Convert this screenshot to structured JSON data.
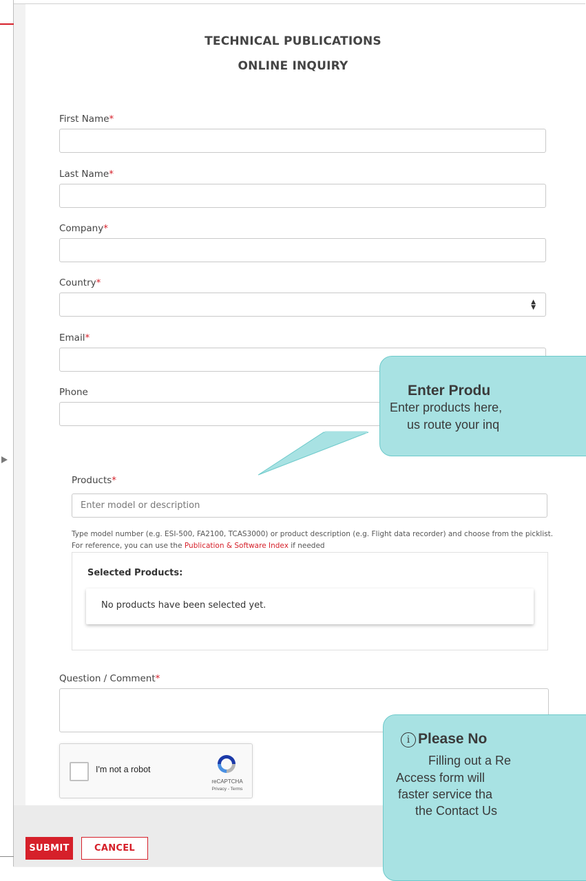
{
  "form": {
    "title_line1": "TECHNICAL PUBLICATIONS",
    "title_line2": "ONLINE INQUIRY",
    "required_mark": "*",
    "first_name_label": "First Name",
    "last_name_label": "Last Name",
    "company_label": "Company",
    "country_label": "Country",
    "email_label": "Email",
    "phone_label": "Phone",
    "products_label": "Products",
    "products_placeholder": "Enter model or description",
    "products_help": "Type model number (e.g. ESI-500, FA2100, TCAS3000) or product description (e.g. Flight data recorder) and choose from the picklist. For reference, you can use the",
    "products_help_link": "Publication & Software Index",
    "products_help_suffix": "if needed",
    "selected_products_title": "Selected Products:",
    "selected_products_empty": "No products have been selected yet.",
    "question_label": "Question / Comment"
  },
  "recaptcha": {
    "label": "I'm not a robot",
    "brand": "reCAPTCHA",
    "terms": "Privacy - Terms"
  },
  "buttons": {
    "submit": "SUBMIT",
    "cancel": "CANCEL"
  },
  "callouts": {
    "products_title": "Enter Produ",
    "products_line1": "Enter products here,",
    "products_line2": "us route your inq",
    "note_icon": "i",
    "note_title": "Please No",
    "note_line1": "Filling out a Re",
    "note_line2": "Access form will",
    "note_line3": "faster service tha",
    "note_line4": "the Contact Us"
  },
  "colors": {
    "brand_red": "#d6202a",
    "callout_teal": "#a8e2e3"
  }
}
